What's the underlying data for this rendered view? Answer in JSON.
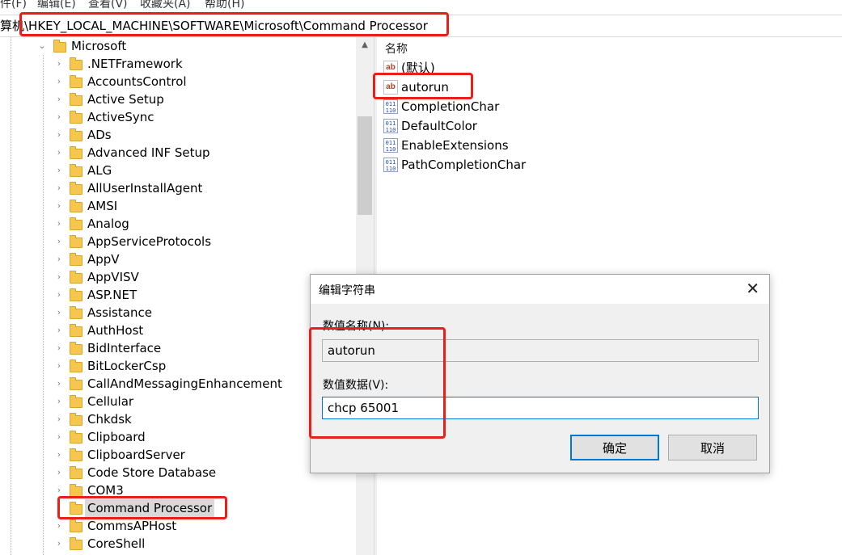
{
  "menu": [
    "件(F)",
    "编辑(E)",
    "查看(V)",
    "收藏夹(A)",
    "帮助(H)"
  ],
  "address": "算机\\HKEY_LOCAL_MACHINE\\SOFTWARE\\Microsoft\\Command Processor",
  "tree": {
    "parent": "Microsoft",
    "children": [
      ".NETFramework",
      "AccountsControl",
      "Active Setup",
      "ActiveSync",
      "ADs",
      "Advanced INF Setup",
      "ALG",
      "AllUserInstallAgent",
      "AMSI",
      "Analog",
      "AppServiceProtocols",
      "AppV",
      "AppVISV",
      "ASP.NET",
      "Assistance",
      "AuthHost",
      "BidInterface",
      "BitLockerCsp",
      "CallAndMessagingEnhancement",
      "Cellular",
      "Chkdsk",
      "Clipboard",
      "ClipboardServer",
      "Code Store Database",
      "COM3",
      "Command Processor",
      "CommsAPHost",
      "CoreShell"
    ],
    "selected": "Command Processor"
  },
  "values": {
    "column_header": "名称",
    "items": [
      {
        "name": "(默认)",
        "icon": "string-value-icon"
      },
      {
        "name": "autorun",
        "icon": "string-value-icon"
      },
      {
        "name": "CompletionChar",
        "icon": "binary-value-icon"
      },
      {
        "name": "DefaultColor",
        "icon": "binary-value-icon"
      },
      {
        "name": "EnableExtensions",
        "icon": "binary-value-icon"
      },
      {
        "name": "PathCompletionChar",
        "icon": "binary-value-icon"
      }
    ]
  },
  "dialog": {
    "title": "编辑字符串",
    "close_glyph": "✕",
    "name_label": "数值名称(N):",
    "name_value": "autorun",
    "data_label": "数值数据(V):",
    "data_value": "chcp 65001",
    "ok_label": "确定",
    "cancel_label": "取消"
  },
  "colors": {
    "highlight": "#e8201a",
    "focus": "#0078d7",
    "folder": "#f5c74f"
  }
}
